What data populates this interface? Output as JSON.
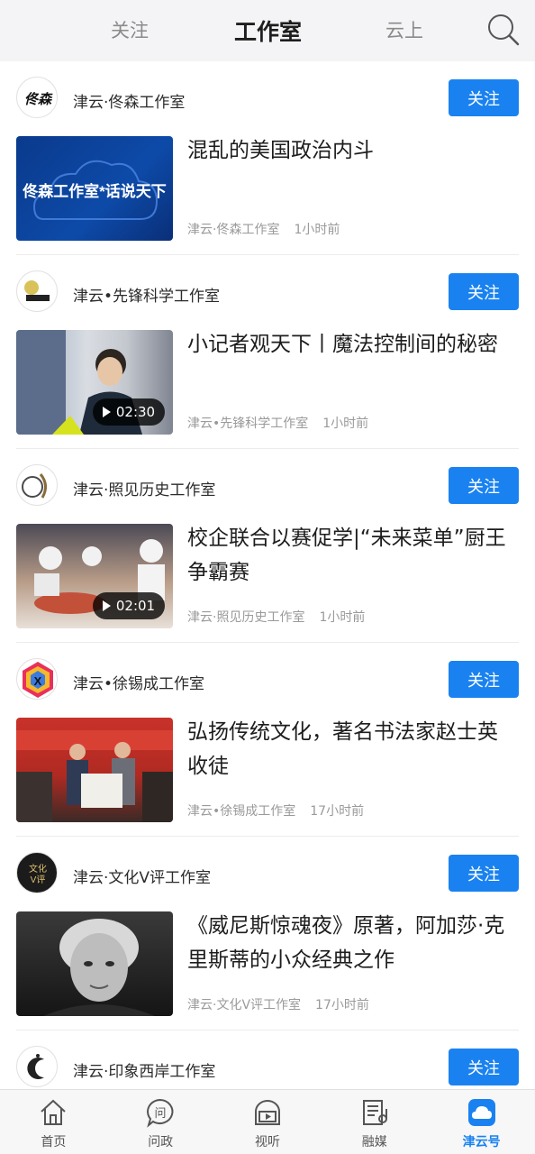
{
  "topnav": {
    "tabs": [
      {
        "label": "关注"
      },
      {
        "label": "工作室"
      },
      {
        "label": "云上"
      }
    ]
  },
  "feed": [
    {
      "studio": "津云·佟森工作室",
      "follow": "关注",
      "title": "混乱的美国政治内斗",
      "source": "津云·佟森工作室",
      "time": "1小时前",
      "thumb_text": "佟森工作室*话说天下",
      "avatar_text": "佟森"
    },
    {
      "studio": "津云•先锋科学工作室",
      "follow": "关注",
      "title": "小记者观天下丨魔法控制间的秘密",
      "source": "津云•先锋科学工作室",
      "time": "1小时前",
      "duration": "02:30"
    },
    {
      "studio": "津云·照见历史工作室",
      "follow": "关注",
      "title": "校企联合以赛促学|“未来菜单”厨王争霸赛",
      "source": "津云·照见历史工作室",
      "time": "1小时前",
      "duration": "02:01"
    },
    {
      "studio": "津云•徐锡成工作室",
      "follow": "关注",
      "title": "弘扬传统文化，著名书法家赵士英收徒",
      "source": "津云•徐锡成工作室",
      "time": "17小时前"
    },
    {
      "studio": "津云·文化V评工作室",
      "follow": "关注",
      "title": "《威尼斯惊魂夜》原著，阿加莎·克里斯蒂的小众经典之作",
      "source": "津云·文化V评工作室",
      "time": "17小时前",
      "avatar_text": "文化V评"
    },
    {
      "studio": "津云·印象西岸工作室",
      "follow": "关注"
    }
  ],
  "tabbar": [
    {
      "label": "首页",
      "icon": "home-icon"
    },
    {
      "label": "问政",
      "icon": "inquiry-icon"
    },
    {
      "label": "视听",
      "icon": "video-icon"
    },
    {
      "label": "融媒",
      "icon": "newspaper-icon"
    },
    {
      "label": "津云号",
      "icon": "cloud-icon",
      "active": true
    }
  ],
  "colors": {
    "accent": "#1a82f0"
  }
}
